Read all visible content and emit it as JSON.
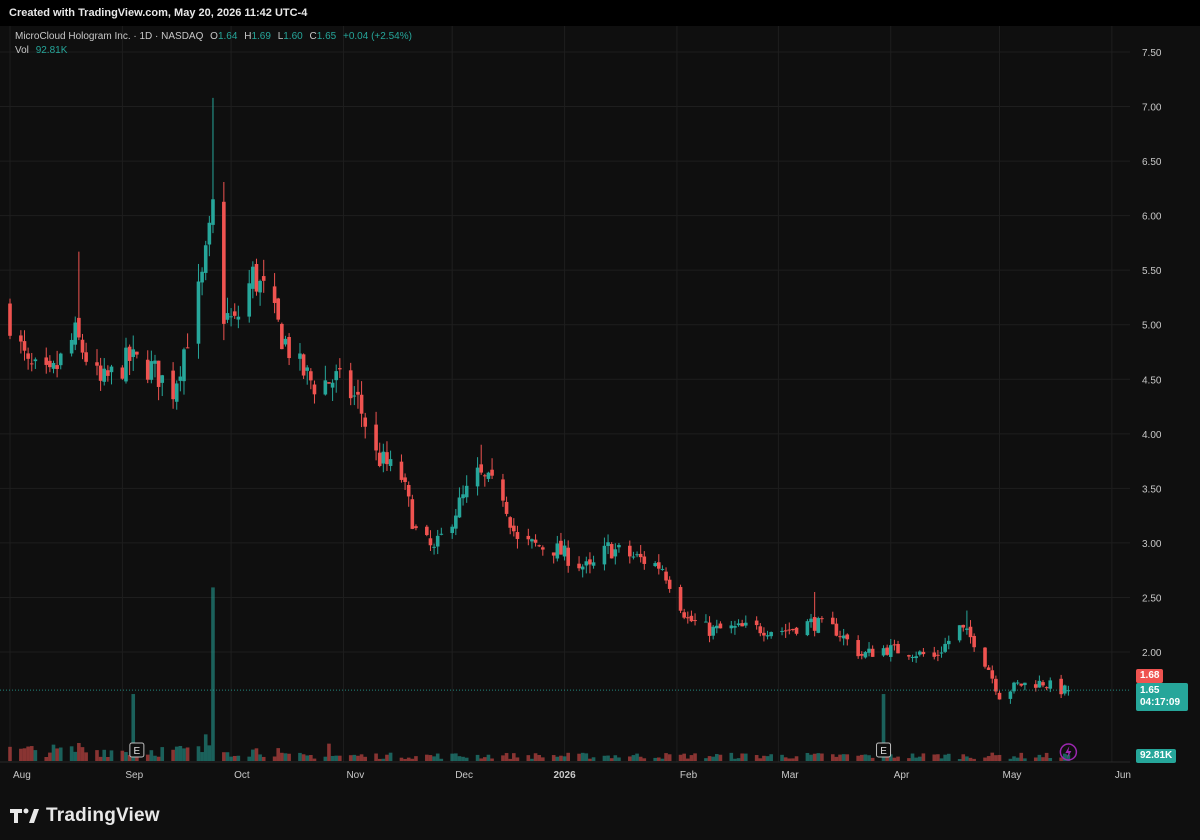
{
  "header": {
    "created_text": "Created with TradingView.com, May 20, 2026 11:42 UTC-4"
  },
  "legend": {
    "symbol": "MicroCloud Hologram Inc. · 1D · NASDAQ",
    "o_label": "O",
    "o_value": "1.64",
    "h_label": "H",
    "h_value": "1.69",
    "l_label": "L",
    "l_value": "1.60",
    "c_label": "C",
    "c_value": "1.65",
    "change": "+0.04 (+2.54%)",
    "vol_label": "Vol",
    "vol_value": "92.81K"
  },
  "price_axis": {
    "ticks": [
      "7.50",
      "7.00",
      "6.50",
      "6.00",
      "5.50",
      "5.00",
      "4.50",
      "4.00",
      "3.50",
      "3.00",
      "2.50",
      "2.00"
    ]
  },
  "badges": {
    "prev_close": "1.68",
    "last_price": "1.65",
    "countdown": "04:17:09",
    "volume": "92.81K"
  },
  "events": {
    "earnings_label": "E"
  },
  "brand": {
    "name": "TradingView"
  },
  "colors": {
    "up": "#26a69a",
    "down": "#ef5350",
    "background": "#0f0f0f",
    "grid": "#1e1e1e",
    "purple": "#9c27b0"
  },
  "chart_data": {
    "type": "candlestick",
    "symbol": "MicroCloud Hologram Inc.",
    "interval": "1D",
    "exchange": "NASDAQ",
    "x_start": "2025-08-01",
    "x_end": "2026-05-20",
    "ylim": [
      1.35,
      7.65
    ],
    "month_labels": [
      {
        "label": "Aug",
        "date": "2025-08-01"
      },
      {
        "label": "Sep",
        "date": "2025-09-01"
      },
      {
        "label": "Oct",
        "date": "2025-10-01"
      },
      {
        "label": "Nov",
        "date": "2025-11-01"
      },
      {
        "label": "Dec",
        "date": "2025-12-01"
      },
      {
        "label": "2026",
        "date": "2026-01-01"
      },
      {
        "label": "Feb",
        "date": "2026-02-01"
      },
      {
        "label": "Mar",
        "date": "2026-03-01"
      },
      {
        "label": "Apr",
        "date": "2026-04-01"
      },
      {
        "label": "May",
        "date": "2026-05-01"
      },
      {
        "label": "Jun",
        "date": "2026-06-01"
      }
    ],
    "earnings_dates": [
      "2025-09-05",
      "2026-03-30"
    ],
    "close_path": [
      [
        "2025-08-01",
        5.05
      ],
      [
        "2025-08-06",
        4.6
      ],
      [
        "2025-08-12",
        4.5
      ],
      [
        "2025-08-19",
        4.9
      ],
      [
        "2025-08-26",
        4.45
      ],
      [
        "2025-09-03",
        4.68
      ],
      [
        "2025-09-09",
        4.6
      ],
      [
        "2025-09-15",
        4.4
      ],
      [
        "2025-09-19",
        4.9
      ],
      [
        "2025-09-23",
        5.4
      ],
      [
        "2025-09-25",
        5.8
      ],
      [
        "2025-09-29",
        5.1
      ],
      [
        "2025-10-02",
        5.0
      ],
      [
        "2025-10-07",
        5.45
      ],
      [
        "2025-10-10",
        5.3
      ],
      [
        "2025-10-15",
        4.9
      ],
      [
        "2025-10-20",
        4.6
      ],
      [
        "2025-10-24",
        4.45
      ],
      [
        "2025-10-30",
        4.5
      ],
      [
        "2025-11-05",
        4.3
      ],
      [
        "2025-11-10",
        3.8
      ],
      [
        "2025-11-17",
        3.6
      ],
      [
        "2025-11-21",
        3.1
      ],
      [
        "2025-11-26",
        2.92
      ],
      [
        "2025-12-02",
        3.3
      ],
      [
        "2025-12-08",
        3.62
      ],
      [
        "2025-12-15",
        3.45
      ],
      [
        "2025-12-19",
        3.0
      ],
      [
        "2025-12-29",
        2.95
      ],
      [
        "2026-01-08",
        2.75
      ],
      [
        "2026-01-13",
        2.95
      ],
      [
        "2026-01-22",
        2.85
      ],
      [
        "2026-01-28",
        2.78
      ],
      [
        "2026-02-04",
        2.3
      ],
      [
        "2026-02-10",
        2.2
      ],
      [
        "2026-02-20",
        2.22
      ],
      [
        "2026-03-03",
        2.2
      ],
      [
        "2026-03-10",
        2.27
      ],
      [
        "2026-03-17",
        2.2
      ],
      [
        "2026-03-24",
        1.97
      ],
      [
        "2026-03-30",
        2.03
      ],
      [
        "2026-04-07",
        2.0
      ],
      [
        "2026-04-13",
        1.95
      ],
      [
        "2026-04-20",
        2.22
      ],
      [
        "2026-04-24",
        2.1
      ],
      [
        "2026-04-28",
        1.85
      ],
      [
        "2026-05-01",
        1.6
      ],
      [
        "2026-05-06",
        1.7
      ],
      [
        "2026-05-13",
        1.72
      ],
      [
        "2026-05-18",
        1.65
      ],
      [
        "2026-05-20",
        1.65
      ]
    ],
    "spikes": [
      {
        "date": "2025-09-26",
        "high": 7.08,
        "close": 6.15
      },
      {
        "date": "2025-08-20",
        "high": 5.67
      },
      {
        "date": "2026-03-11",
        "high": 2.55
      },
      {
        "date": "2026-04-22",
        "high": 2.38
      },
      {
        "date": "2025-12-09",
        "high": 3.9
      }
    ],
    "volume": {
      "baseline": 92810,
      "spikes": [
        {
          "date": "2025-09-26",
          "ratio": 28
        },
        {
          "date": "2025-09-04",
          "ratio": 10.8
        },
        {
          "date": "2026-03-30",
          "ratio": 10.8
        },
        {
          "date": "2025-10-28",
          "ratio": 2.8
        },
        {
          "date": "2025-08-20",
          "ratio": 2.9
        },
        {
          "date": "2025-09-24",
          "ratio": 4.3
        }
      ]
    }
  }
}
